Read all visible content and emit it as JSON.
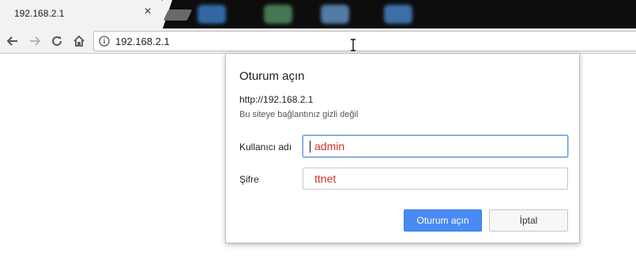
{
  "tab": {
    "title": "192.168.2.1",
    "close_glyph": "×"
  },
  "toolbar": {
    "url": "192.168.2.1",
    "back_icon": "arrow-left-icon",
    "forward_icon": "arrow-right-icon",
    "reload_icon": "reload-icon",
    "home_icon": "home-icon",
    "info_icon": "info-icon"
  },
  "dialog": {
    "title": "Oturum açın",
    "url": "http://192.168.2.1",
    "note": "Bu siteye bağlantınız gizli değil",
    "username_label": "Kullanıcı adı",
    "username_value": "admin",
    "password_label": "Şifre",
    "password_value": "ttnet",
    "submit_label": "Oturum açın",
    "cancel_label": "İptal"
  },
  "colors": {
    "tabstrip_bg": "#0d0d0d",
    "toolbar_bg": "#f2f2f2",
    "primary_button": "#4a8af4",
    "field_text": "#d1322e"
  }
}
